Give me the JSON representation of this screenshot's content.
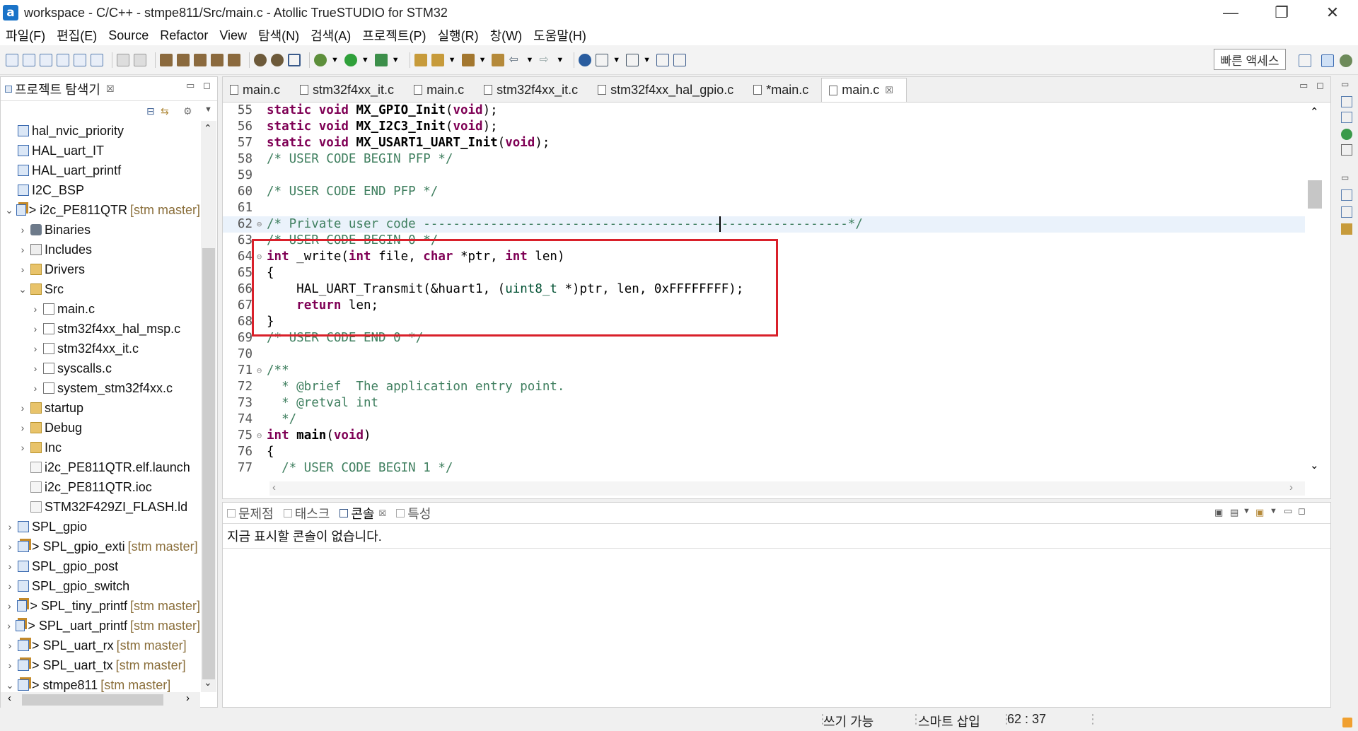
{
  "window": {
    "title": "workspace - C/C++ - stmpe811/Src/main.c - Atollic TrueSTUDIO for STM32",
    "app_icon_letter": "a",
    "minimize": "—",
    "restore": "❐",
    "close": "✕"
  },
  "menu": [
    "파일(F)",
    "편집(E)",
    "Source",
    "Refactor",
    "View",
    "탐색(N)",
    "검색(A)",
    "프로젝트(P)",
    "실행(R)",
    "창(W)",
    "도움말(H)"
  ],
  "toolbar": {
    "quick_access": "빠른 액세스"
  },
  "project_explorer": {
    "title": "프로젝트 탐색기",
    "close_glyph": "☒",
    "items": [
      {
        "label": "hal_nvic_priority",
        "indent": 0,
        "arrow": "",
        "icon": "project-icon",
        "repo": ""
      },
      {
        "label": "HAL_uart_IT",
        "indent": 0,
        "arrow": "",
        "icon": "project-icon",
        "repo": ""
      },
      {
        "label": "HAL_uart_printf",
        "indent": 0,
        "arrow": "",
        "icon": "project-icon",
        "repo": ""
      },
      {
        "label": "I2C_BSP",
        "indent": 0,
        "arrow": "",
        "icon": "project-icon",
        "repo": ""
      },
      {
        "label": "> i2c_PE811QTR",
        "indent": 0,
        "arrow": "⌄",
        "icon": "git-project-icon",
        "repo": "[stm master]"
      },
      {
        "label": "Binaries",
        "indent": 1,
        "arrow": "›",
        "icon": "binaries-icon",
        "repo": ""
      },
      {
        "label": "Includes",
        "indent": 1,
        "arrow": "›",
        "icon": "includes-icon",
        "repo": ""
      },
      {
        "label": "Drivers",
        "indent": 1,
        "arrow": "›",
        "icon": "folder-icon",
        "repo": ""
      },
      {
        "label": "Src",
        "indent": 1,
        "arrow": "⌄",
        "icon": "folder-icon",
        "repo": ""
      },
      {
        "label": "main.c",
        "indent": 2,
        "arrow": "›",
        "icon": "c-file-icon",
        "repo": ""
      },
      {
        "label": "stm32f4xx_hal_msp.c",
        "indent": 2,
        "arrow": "›",
        "icon": "c-file-icon",
        "repo": ""
      },
      {
        "label": "stm32f4xx_it.c",
        "indent": 2,
        "arrow": "›",
        "icon": "c-file-icon",
        "repo": ""
      },
      {
        "label": "syscalls.c",
        "indent": 2,
        "arrow": "›",
        "icon": "c-file-icon",
        "repo": ""
      },
      {
        "label": "system_stm32f4xx.c",
        "indent": 2,
        "arrow": "›",
        "icon": "c-file-icon",
        "repo": ""
      },
      {
        "label": "startup",
        "indent": 1,
        "arrow": "›",
        "icon": "folder-icon",
        "repo": ""
      },
      {
        "label": "Debug",
        "indent": 1,
        "arrow": "›",
        "icon": "folder-icon",
        "repo": ""
      },
      {
        "label": "Inc",
        "indent": 1,
        "arrow": "›",
        "icon": "folder-icon",
        "repo": ""
      },
      {
        "label": "i2c_PE811QTR.elf.launch",
        "indent": 1,
        "arrow": "",
        "icon": "file-icon",
        "repo": ""
      },
      {
        "label": "i2c_PE811QTR.ioc",
        "indent": 1,
        "arrow": "",
        "icon": "file-icon",
        "repo": ""
      },
      {
        "label": "STM32F429ZI_FLASH.ld",
        "indent": 1,
        "arrow": "",
        "icon": "file-icon",
        "repo": ""
      },
      {
        "label": "SPL_gpio",
        "indent": 0,
        "arrow": "›",
        "icon": "project-icon",
        "repo": ""
      },
      {
        "label": "> SPL_gpio_exti",
        "indent": 0,
        "arrow": "›",
        "icon": "git-project-icon",
        "repo": "[stm master]"
      },
      {
        "label": "SPL_gpio_post",
        "indent": 0,
        "arrow": "›",
        "icon": "project-icon",
        "repo": ""
      },
      {
        "label": "SPL_gpio_switch",
        "indent": 0,
        "arrow": "›",
        "icon": "project-icon",
        "repo": ""
      },
      {
        "label": "> SPL_tiny_printf",
        "indent": 0,
        "arrow": "›",
        "icon": "git-project-icon",
        "repo": "[stm master]"
      },
      {
        "label": "> SPL_uart_printf",
        "indent": 0,
        "arrow": "›",
        "icon": "git-project-icon",
        "repo": "[stm master]"
      },
      {
        "label": "> SPL_uart_rx",
        "indent": 0,
        "arrow": "›",
        "icon": "git-project-icon",
        "repo": "[stm master]"
      },
      {
        "label": "> SPL_uart_tx",
        "indent": 0,
        "arrow": "›",
        "icon": "git-project-icon",
        "repo": "[stm master]"
      },
      {
        "label": "> stmpe811",
        "indent": 0,
        "arrow": "⌄",
        "icon": "git-project-icon",
        "repo": "[stm master]"
      }
    ]
  },
  "editor": {
    "tabs": [
      {
        "label": "main.c",
        "active": false
      },
      {
        "label": "stm32f4xx_it.c",
        "active": false
      },
      {
        "label": "main.c",
        "active": false
      },
      {
        "label": "stm32f4xx_it.c",
        "active": false
      },
      {
        "label": "stm32f4xx_hal_gpio.c",
        "active": false
      },
      {
        "label": "*main.c",
        "active": false
      },
      {
        "label": "main.c",
        "active": true
      }
    ],
    "tab_close": "☒",
    "lines": [
      {
        "n": "55",
        "fold": "",
        "text": "static void MX_GPIO_Init(void);"
      },
      {
        "n": "56",
        "fold": "",
        "text": "static void MX_I2C3_Init(void);"
      },
      {
        "n": "57",
        "fold": "",
        "text": "static void MX_USART1_UART_Init(void);"
      },
      {
        "n": "58",
        "fold": "",
        "text": "/* USER CODE BEGIN PFP */"
      },
      {
        "n": "59",
        "fold": "",
        "text": ""
      },
      {
        "n": "60",
        "fold": "",
        "text": "/* USER CODE END PFP */"
      },
      {
        "n": "61",
        "fold": "",
        "text": ""
      },
      {
        "n": "62",
        "fold": "⊖",
        "text": "/* Private user code ---------------------------------------------------------*/"
      },
      {
        "n": "63",
        "fold": "",
        "text": "/* USER CODE BEGIN 0 */"
      },
      {
        "n": "64",
        "fold": "⊖",
        "text": "int _write(int file, char *ptr, int len)"
      },
      {
        "n": "65",
        "fold": "",
        "text": "{"
      },
      {
        "n": "66",
        "fold": "",
        "text": "    HAL_UART_Transmit(&huart1, (uint8_t *)ptr, len, 0xFFFFFFFF);"
      },
      {
        "n": "67",
        "fold": "",
        "text": "    return len;"
      },
      {
        "n": "68",
        "fold": "",
        "text": "}"
      },
      {
        "n": "69",
        "fold": "",
        "text": "/* USER CODE END 0 */"
      },
      {
        "n": "70",
        "fold": "",
        "text": ""
      },
      {
        "n": "71",
        "fold": "⊖",
        "text": "/**"
      },
      {
        "n": "72",
        "fold": "",
        "text": "  * @brief  The application entry point."
      },
      {
        "n": "73",
        "fold": "",
        "text": "  * @retval int"
      },
      {
        "n": "74",
        "fold": "",
        "text": "  */"
      },
      {
        "n": "75",
        "fold": "⊖",
        "text": "int main(void)"
      },
      {
        "n": "76",
        "fold": "",
        "text": "{"
      },
      {
        "n": "77",
        "fold": "",
        "text": "  /* USER CODE BEGIN 1 */"
      }
    ]
  },
  "console": {
    "tabs": [
      {
        "label": "문제점",
        "active": false
      },
      {
        "label": "태스크",
        "active": false
      },
      {
        "label": "콘솔",
        "active": true
      },
      {
        "label": "특성",
        "active": false
      }
    ],
    "message": "지금 표시할 콘솔이 없습니다."
  },
  "status": {
    "writable": "쓰기 가능",
    "insert_mode": "스마트 삽입",
    "position": "62 : 37"
  },
  "colors": {
    "keyword": "#7f0055",
    "comment": "#3f7f5f",
    "highlight_box": "#d9202a"
  }
}
